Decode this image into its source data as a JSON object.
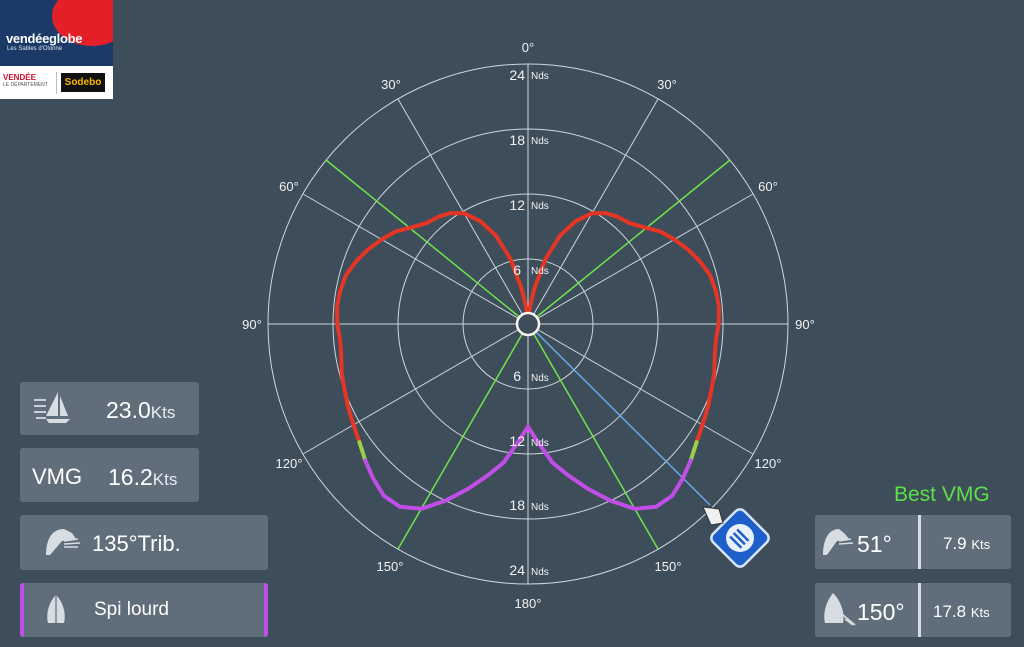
{
  "logo": {
    "brand": "vendéeglobe",
    "tagline": "Les Sables d'Olonne",
    "sponsor1": "VENDÉE",
    "sponsor1_sub": "LE DÉPARTEMENT",
    "sponsor2": "Sodebo"
  },
  "polar": {
    "angle_labels": {
      "top": "0°",
      "bottom": "180°",
      "left90": "90°",
      "right90": "90°",
      "left30": "30°",
      "right30": "30°",
      "left60": "60°",
      "right60": "60°",
      "left120": "120°",
      "right120": "120°",
      "left150": "150°",
      "right150": "150°"
    },
    "upper_ring_values": [
      "6",
      "12",
      "18",
      "24"
    ],
    "lower_ring_values": [
      "6",
      "12",
      "18",
      "24"
    ],
    "ring_unit": "Nds",
    "colors": {
      "upwind": "#e53524",
      "transition": "#9bd144",
      "spinnaker": "#c04ee6",
      "vmg_line": "#6fe34a",
      "heading_line": "#6aa9e8",
      "grid": "#cfd6dc"
    }
  },
  "chart_data": {
    "type": "polar",
    "title": "",
    "unit": "Nds",
    "angle_range_deg": [
      0,
      180
    ],
    "speed_max": 24,
    "series": [
      {
        "angle_deg": [
          0,
          5,
          10,
          15,
          20,
          25,
          30,
          35,
          40,
          45,
          50,
          55,
          60,
          65,
          70,
          75,
          80,
          85,
          90,
          95,
          100,
          105,
          110,
          115,
          120,
          125
        ],
        "speed": [
          0,
          1.2,
          3.2,
          6.2,
          8.7,
          10.5,
          11.8,
          12.5,
          12.9,
          13.2,
          13.9,
          14.9,
          15.6,
          16.3,
          16.9,
          17.4,
          17.6,
          17.7,
          17.6,
          17.4,
          17.5,
          17.8,
          18.0,
          18.3,
          18.6,
          19.0
        ]
      },
      {
        "angle_deg": [
          125,
          130
        ],
        "speed": [
          19.0,
          19.6
        ]
      },
      {
        "angle_deg": [
          130,
          135,
          140,
          145,
          150,
          155,
          160,
          165,
          170,
          175,
          180
        ],
        "speed": [
          19.6,
          20.2,
          20.7,
          20.6,
          19.7,
          18.0,
          16.2,
          14.5,
          13.0,
          11.0,
          9.5
        ]
      }
    ],
    "vmg_angles_deg": [
      51,
      150
    ],
    "current_heading_deg": 135
  },
  "readouts": {
    "boat_speed": {
      "value": "23.0",
      "unit": "Kts"
    },
    "vmg": {
      "label": "VMG",
      "value": "16.2",
      "unit": "Kts"
    },
    "wind_angle": {
      "value": "135°Trib."
    },
    "sail": {
      "name": "Spi lourd"
    }
  },
  "best_vmg": {
    "title": "Best VMG",
    "upwind": {
      "angle": "51°",
      "speed": "7.9",
      "unit": "Kts"
    },
    "downwind": {
      "angle": "150°",
      "speed": "17.8",
      "unit": "Kts"
    }
  }
}
